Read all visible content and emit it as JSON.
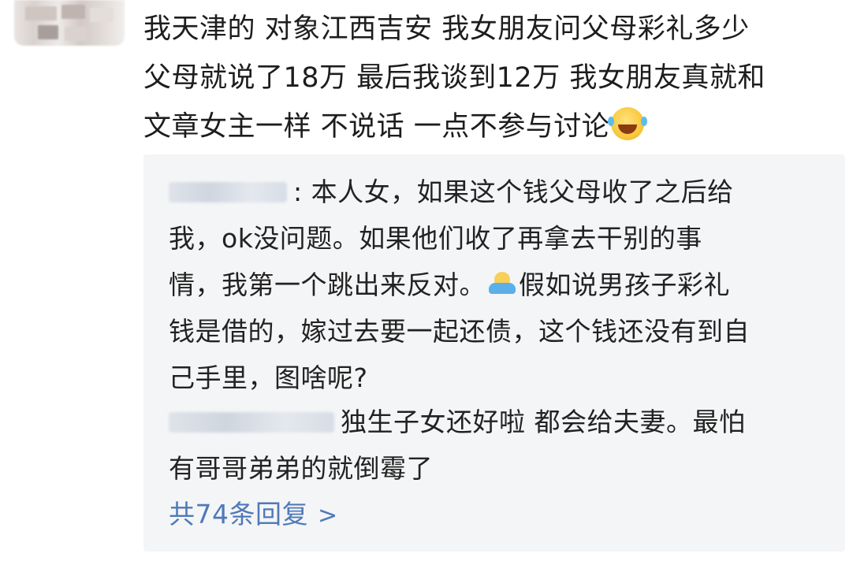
{
  "comment": {
    "lines": [
      "我天津的 对象江西吉安 我女朋友问父母彩礼多少",
      "父母就说了18万 最后我谈到12万 我女朋友真就和",
      "文章女主一样 不说话 一点不参与讨论"
    ]
  },
  "replies": [
    {
      "author_blurred": true,
      "lines": [
        ": 本人女，如果这个钱父母收了之后给",
        "我，ok没问题。如果他们收了再拿去干别的事",
        "情，我第一个跳出来反对。",
        "假如说男孩子彩礼",
        "钱是借的，嫁过去要一起还债，这个钱还没有到自",
        "己手里，图啥呢?"
      ]
    },
    {
      "author_blurred": true,
      "lines": [
        "独生子女还好啦 都会给夫妻。最怕",
        "有哥哥弟弟的就倒霉了"
      ]
    }
  ],
  "more": {
    "label": "共74条回复",
    "chevron": ">",
    "color": "#4f79b8"
  },
  "icons": {
    "comment_emoji": "laugh-cry-icon",
    "reply_emoji": "hug-icon"
  },
  "colors": {
    "reply_bg": "#f4f5f7",
    "link": "#4f79b8"
  }
}
